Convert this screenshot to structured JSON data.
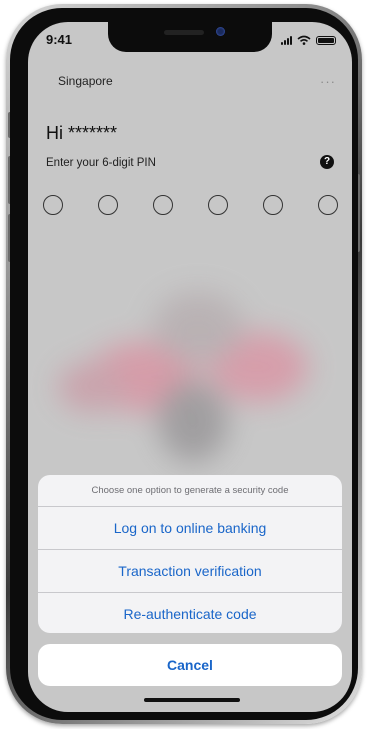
{
  "status_bar": {
    "time": "9:41"
  },
  "header": {
    "region": "Singapore",
    "more": "…"
  },
  "login": {
    "greeting": "Hi *******",
    "pin_prompt": "Enter your 6-digit PIN",
    "help_glyph": "?",
    "pin_length": 6
  },
  "action_sheet": {
    "title": "Choose one option to generate a security code",
    "options": [
      {
        "label": "Log on to online banking"
      },
      {
        "label": "Transaction verification"
      },
      {
        "label": "Re-authenticate code"
      }
    ],
    "cancel_label": "Cancel"
  },
  "colors": {
    "accent": "#1a66c9",
    "screen_bg": "#c7c7c7",
    "sheet_bg": "#f5f5f7"
  }
}
